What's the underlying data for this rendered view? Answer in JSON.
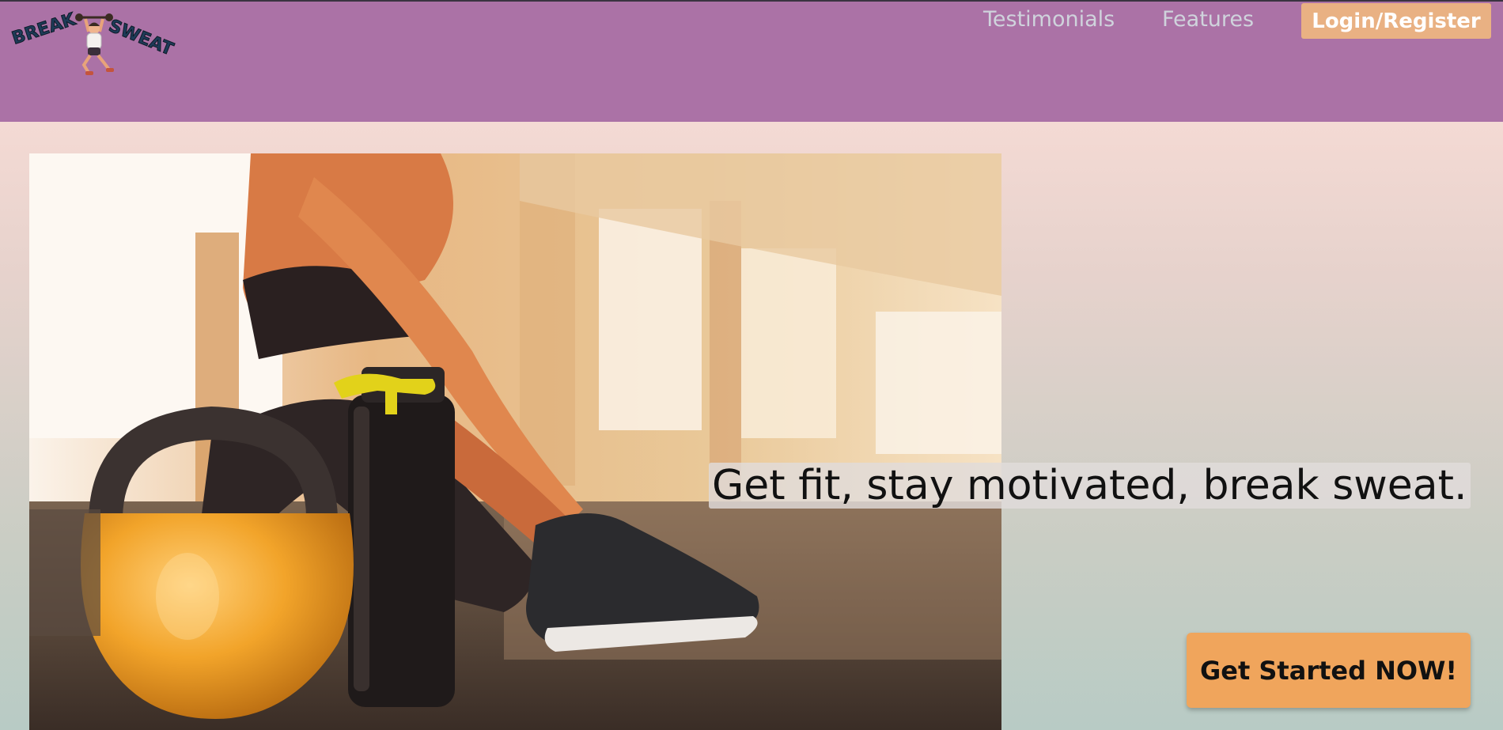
{
  "header": {
    "logo": {
      "text": "BREAK SWEAT",
      "icon": "weightlifter-logo-icon"
    },
    "nav": [
      {
        "label": "Testimonials"
      },
      {
        "label": "Features"
      }
    ],
    "login_label": "Login/Register"
  },
  "hero": {
    "image": "gym-kettlebell-bottle-photo",
    "tagline": "Get fit, stay motivated, break sweat.",
    "cta_label": "Get Started NOW!"
  },
  "colors": {
    "navbar": "#ab72a6",
    "nav_link": "#cfd3dc",
    "login_button": "#e9b183",
    "cta_button": "#f0a55c"
  }
}
